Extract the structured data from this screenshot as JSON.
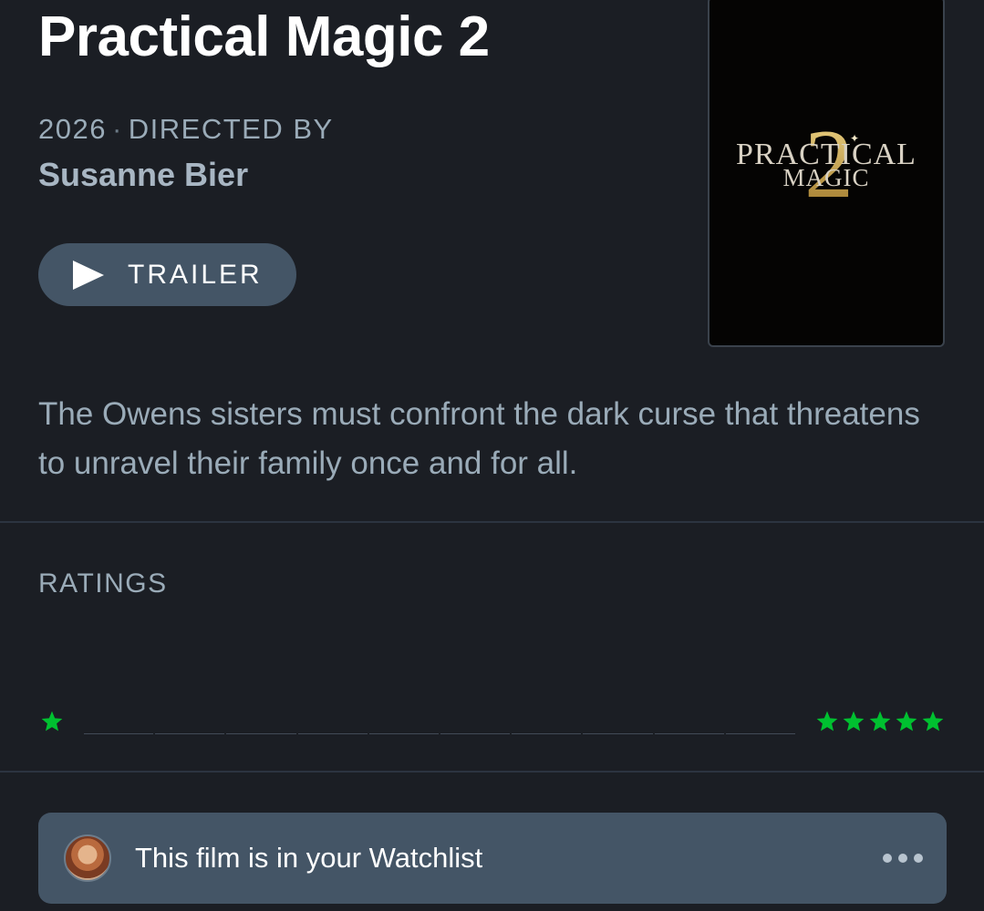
{
  "film": {
    "title": "Practical Magic 2",
    "year": "2026",
    "separator": "·",
    "directed_by_label": "DIRECTED BY",
    "director": "Susanne Bier",
    "trailer_label": "TRAILER",
    "synopsis": "The Owens sisters must confront the dark curse that threatens to unravel their family once and for all.",
    "poster": {
      "line1": "PRACTICAL",
      "line2": "MAGIC",
      "numeral": "2"
    }
  },
  "ratings": {
    "label": "RATINGS",
    "low_icon": "star-icon",
    "high_icon": "five-stars-icon",
    "histogram_fractions": [
      0,
      0,
      0,
      0,
      0,
      0,
      0,
      0,
      0,
      0
    ],
    "star_color": "#00c030"
  },
  "watchlist": {
    "text": "This film is in your Watchlist",
    "more_icon": "ellipsis-icon"
  },
  "colors": {
    "background": "#1b1e24",
    "button": "#445566",
    "accent_green": "#00c030"
  }
}
